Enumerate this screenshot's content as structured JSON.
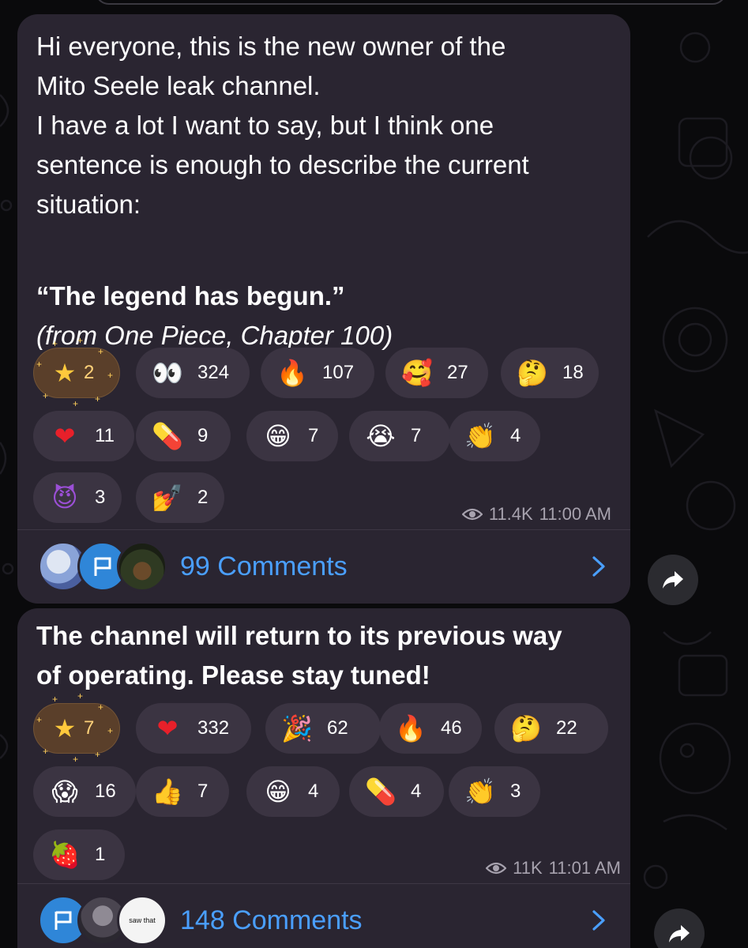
{
  "post1": {
    "text_lines": "Hi everyone, this is the new owner of the\nMito Seele leak channel.\nI have a lot I want to say, but I think one\nsentence is enough to describe the current\nsituation:",
    "quote": "“The legend has begun.”",
    "source": "(from One Piece, Chapter 100)",
    "reactions": [
      {
        "icon": "star-icon",
        "emoji": "★",
        "count": "2"
      },
      {
        "icon": "eyes-emoji",
        "emoji": "👀",
        "count": "324"
      },
      {
        "icon": "fire-emoji",
        "emoji": "🔥",
        "count": "107"
      },
      {
        "icon": "smiling-hearts-emoji",
        "emoji": "🥰",
        "count": "27"
      },
      {
        "icon": "thinking-emoji",
        "emoji": "🤔",
        "count": "18"
      },
      {
        "icon": "heart-emoji",
        "emoji": "❤",
        "count": "11"
      },
      {
        "icon": "pill-emoji",
        "emoji": "💊",
        "count": "9"
      },
      {
        "icon": "grin-emoji",
        "emoji": "😁",
        "count": "7"
      },
      {
        "icon": "crying-emoji",
        "emoji": "😭",
        "count": "7"
      },
      {
        "icon": "clap-emoji",
        "emoji": "👏",
        "count": "4"
      },
      {
        "icon": "devil-emoji",
        "emoji": "😈",
        "count": "3"
      },
      {
        "icon": "nail-polish-emoji",
        "emoji": "💅",
        "count": "2"
      }
    ],
    "views": "11.4K",
    "time": "11:00 AM",
    "comments": "99 Comments"
  },
  "post2": {
    "text": "The channel will return to its previous way\nof operating. Please stay tuned!",
    "reactions": [
      {
        "icon": "star-icon",
        "emoji": "★",
        "count": "7"
      },
      {
        "icon": "heart-emoji",
        "emoji": "❤",
        "count": "332"
      },
      {
        "icon": "party-popper-emoji",
        "emoji": "🎉",
        "count": "62"
      },
      {
        "icon": "fire-emoji",
        "emoji": "🔥",
        "count": "46"
      },
      {
        "icon": "thinking-emoji",
        "emoji": "🤔",
        "count": "22"
      },
      {
        "icon": "scream-emoji",
        "emoji": "😱",
        "count": "16"
      },
      {
        "icon": "thumbs-up-emoji",
        "emoji": "👍",
        "count": "7"
      },
      {
        "icon": "grin-emoji",
        "emoji": "😁",
        "count": "4"
      },
      {
        "icon": "pill-emoji",
        "emoji": "💊",
        "count": "4"
      },
      {
        "icon": "clap-emoji",
        "emoji": "👏",
        "count": "3"
      },
      {
        "icon": "strawberry-emoji",
        "emoji": "🍓",
        "count": "1"
      }
    ],
    "views": "11K",
    "time": "11:01 AM",
    "comments": "148 Comments",
    "avatar_text": "saw that"
  },
  "colors": {
    "bubble": "#2a2531",
    "reaction_pill": "#3b3442",
    "star_pill": "#5a3f2a",
    "link": "#4a9fff",
    "meta": "#a7a2ae"
  }
}
